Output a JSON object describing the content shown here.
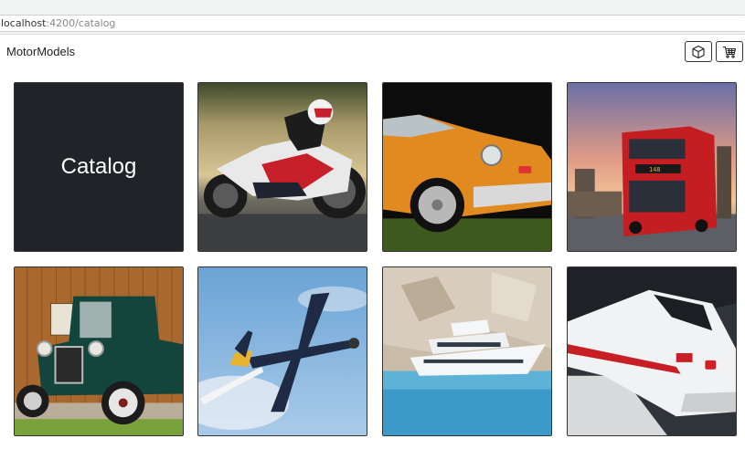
{
  "browser": {
    "url_host": "localhost",
    "url_rest": ":4200/catalog"
  },
  "app": {
    "brand": "MotorModels",
    "icons": {
      "box": "box-icon",
      "cart": "cart-icon"
    }
  },
  "catalog": {
    "title_tile": "Catalog",
    "tiles": [
      {
        "name": "motorcycle",
        "alt": "Motorcycle"
      },
      {
        "name": "sports-car",
        "alt": "Sports car"
      },
      {
        "name": "double-decker-bus",
        "alt": "Bus"
      },
      {
        "name": "vintage-car",
        "alt": "Vintage car"
      },
      {
        "name": "airplane",
        "alt": "Airplane"
      },
      {
        "name": "yacht",
        "alt": "Yacht"
      },
      {
        "name": "train",
        "alt": "Train"
      }
    ]
  },
  "colors": {
    "tile_dark": "#202327",
    "border": "#333333"
  }
}
